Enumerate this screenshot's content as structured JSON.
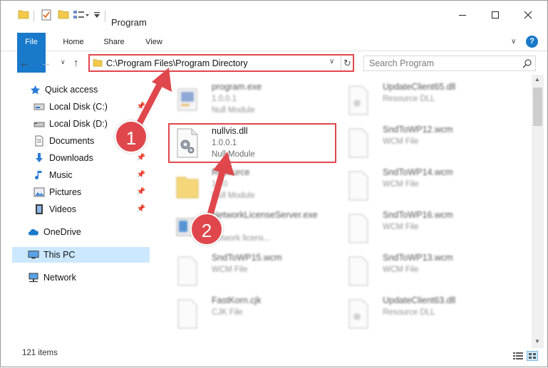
{
  "window": {
    "title": "Program"
  },
  "tabs": {
    "file": "File",
    "home": "Home",
    "share": "Share",
    "view": "View"
  },
  "address": {
    "path": "C:\\Program Files\\Program Directory"
  },
  "search": {
    "placeholder": "Search Program"
  },
  "nav": {
    "quick_access": "Quick access",
    "items": [
      {
        "label": "Local Disk (C:)",
        "icon": "drive-icon",
        "pinned": true
      },
      {
        "label": "Local Disk (D:)",
        "icon": "drive-icon",
        "pinned": false
      },
      {
        "label": "Documents",
        "icon": "documents-icon",
        "pinned": true
      },
      {
        "label": "Downloads",
        "icon": "downloads-icon",
        "pinned": true
      },
      {
        "label": "Music",
        "icon": "music-icon",
        "pinned": true
      },
      {
        "label": "Pictures",
        "icon": "pictures-icon",
        "pinned": true
      },
      {
        "label": "Videos",
        "icon": "videos-icon",
        "pinned": true
      }
    ],
    "onedrive": "OneDrive",
    "this_pc": "This PC",
    "network": "Network"
  },
  "files": [
    {
      "name": "program.exe",
      "line1": "1.0.0.1",
      "line2": "Null Module",
      "icon": "exe-icon"
    },
    {
      "name": "nullvis.dll",
      "line1": "1.0.0.1",
      "line2": "Null Module",
      "icon": "dll-gear-icon",
      "highlighted": true
    },
    {
      "name": "Resource",
      "line1": "10.0",
      "line2": "Null Module",
      "icon": "folder-icon"
    },
    {
      "name": "NetworkLicenseServer.exe",
      "line1": "",
      "line2": "network licens...",
      "icon": "exe-icon"
    },
    {
      "name": "SndToWP15.wcm",
      "line1": "WCM File",
      "line2": "",
      "icon": "file-icon"
    },
    {
      "name": "FastKorn.cjk",
      "line1": "CJK File",
      "line2": "",
      "icon": "file-icon"
    },
    {
      "name": "UpdateClient65.dll",
      "line1": "Resource DLL",
      "line2": "",
      "icon": "file-icon"
    },
    {
      "name": "SndToWP12.wcm",
      "line1": "WCM File",
      "line2": "",
      "icon": "file-icon"
    },
    {
      "name": "SndToWP14.wcm",
      "line1": "WCM File",
      "line2": "",
      "icon": "file-icon"
    },
    {
      "name": "SndToWP16.wcm",
      "line1": "WCM File",
      "line2": "",
      "icon": "file-icon"
    },
    {
      "name": "SndToWP13.wcm",
      "line1": "WCM File",
      "line2": "",
      "icon": "file-icon"
    },
    {
      "name": "UpdateClient63.dll",
      "line1": "Resource DLL",
      "line2": "",
      "icon": "file-icon"
    }
  ],
  "status": {
    "count": "121 items"
  },
  "callouts": {
    "one": "1",
    "two": "2"
  },
  "colors": {
    "accent": "#1979ca",
    "highlight": "#e0474c",
    "selected_nav": "#cce8ff"
  }
}
